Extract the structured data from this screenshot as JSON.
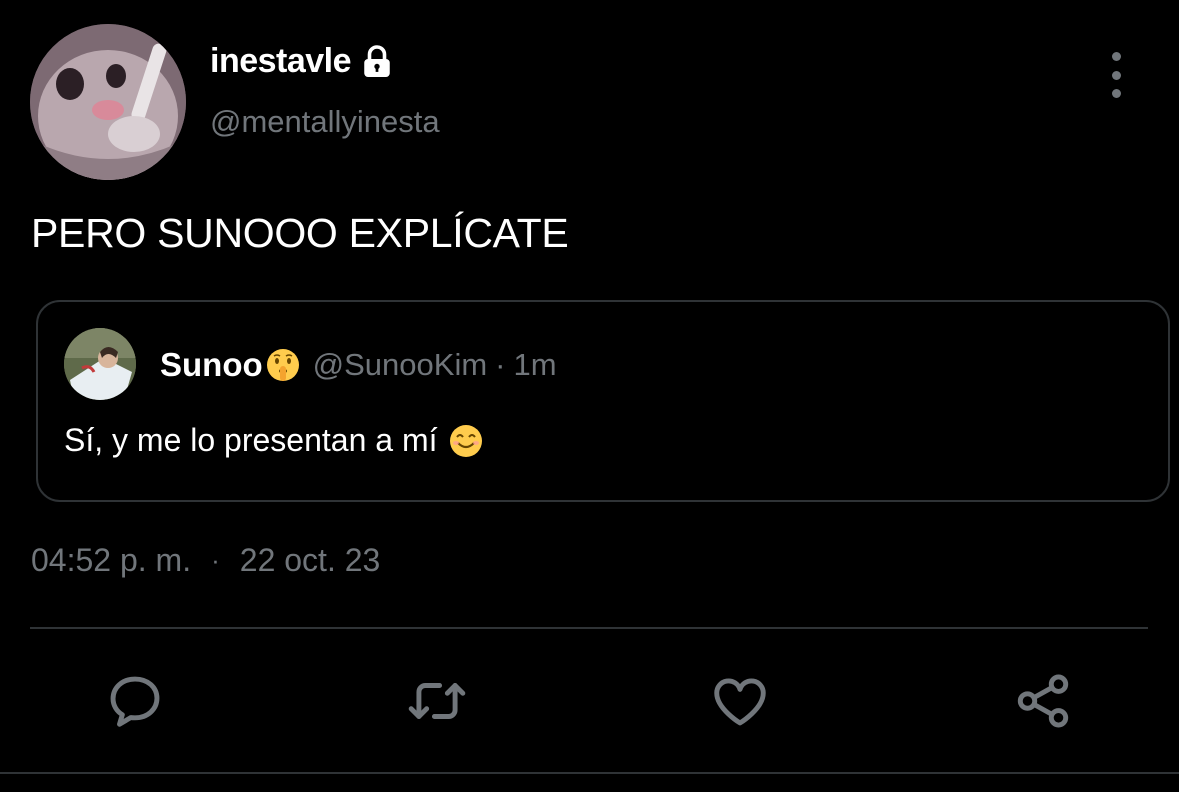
{
  "author": {
    "display_name": "inestavle",
    "handle": "@mentallyinesta",
    "protected": true
  },
  "tweet": {
    "text": "PERO SUNOOO EXPLÍCATE",
    "time": "04:52 p. m.",
    "separator": "·",
    "date": "22 oct. 23"
  },
  "quoted_tweet": {
    "display_name": "Sunoo",
    "name_emoji": "shushing-face",
    "handle": "@SunooKim",
    "separator": "·",
    "time_ago": "1m",
    "text": "Sí, y me lo presentan a mí",
    "text_emoji": "smiling-face"
  },
  "actions": [
    "reply-icon",
    "retweet-icon",
    "like-icon",
    "share-icon"
  ],
  "colors": {
    "background": "#000000",
    "primary_text": "#ffffff",
    "secondary_text": "#71767b",
    "border": "#2f3336"
  }
}
